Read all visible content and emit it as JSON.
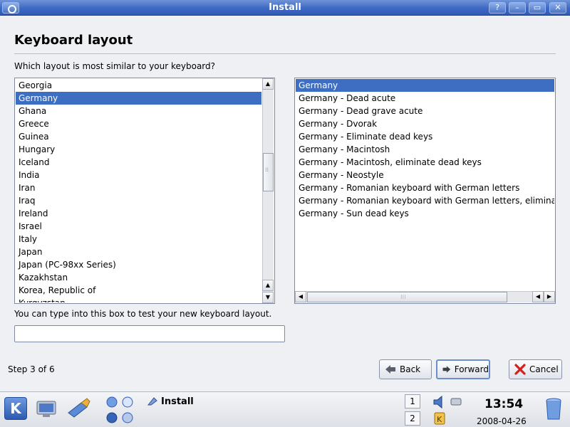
{
  "window": {
    "title": "Install",
    "buttons": {
      "help": "?",
      "minimize": "–",
      "maximize": "▭",
      "close": "✕"
    }
  },
  "page": {
    "heading": "Keyboard layout",
    "question": "Which layout is most similar to your keyboard?",
    "test_hint": "You can type into this box to test your new keyboard layout.",
    "test_value": "",
    "step": "Step 3 of 6"
  },
  "countries": [
    "Georgia",
    "Germany",
    "Ghana",
    "Greece",
    "Guinea",
    "Hungary",
    "Iceland",
    "India",
    "Iran",
    "Iraq",
    "Ireland",
    "Israel",
    "Italy",
    "Japan",
    "Japan (PC-98xx Series)",
    "Kazakhstan",
    "Korea, Republic of",
    "Kyrgyzstan"
  ],
  "countries_selected": "Germany",
  "variants": [
    "Germany",
    "Germany - Dead acute",
    "Germany - Dead grave acute",
    "Germany - Dvorak",
    "Germany - Eliminate dead keys",
    "Germany - Macintosh",
    "Germany - Macintosh, eliminate dead keys",
    "Germany - Neostyle",
    "Germany - Romanian keyboard with German letters",
    "Germany - Romanian keyboard with German letters, eliminate dead keys",
    "Germany - Sun dead keys"
  ],
  "variants_selected": "Germany",
  "buttons": {
    "back": "Back",
    "forward": "Forward",
    "cancel": "Cancel"
  },
  "icons": {
    "back": "arrow-left-icon",
    "forward": "arrow-right-icon",
    "cancel": "red-x-icon"
  },
  "colors": {
    "selection": "#3d6ec2",
    "titlebar": "#3e69c3"
  },
  "taskbar": {
    "kmenu": "K",
    "active_task": "Install",
    "desktops": [
      "1",
      "2"
    ],
    "clock": "13:54",
    "date": "2008-04-26"
  }
}
